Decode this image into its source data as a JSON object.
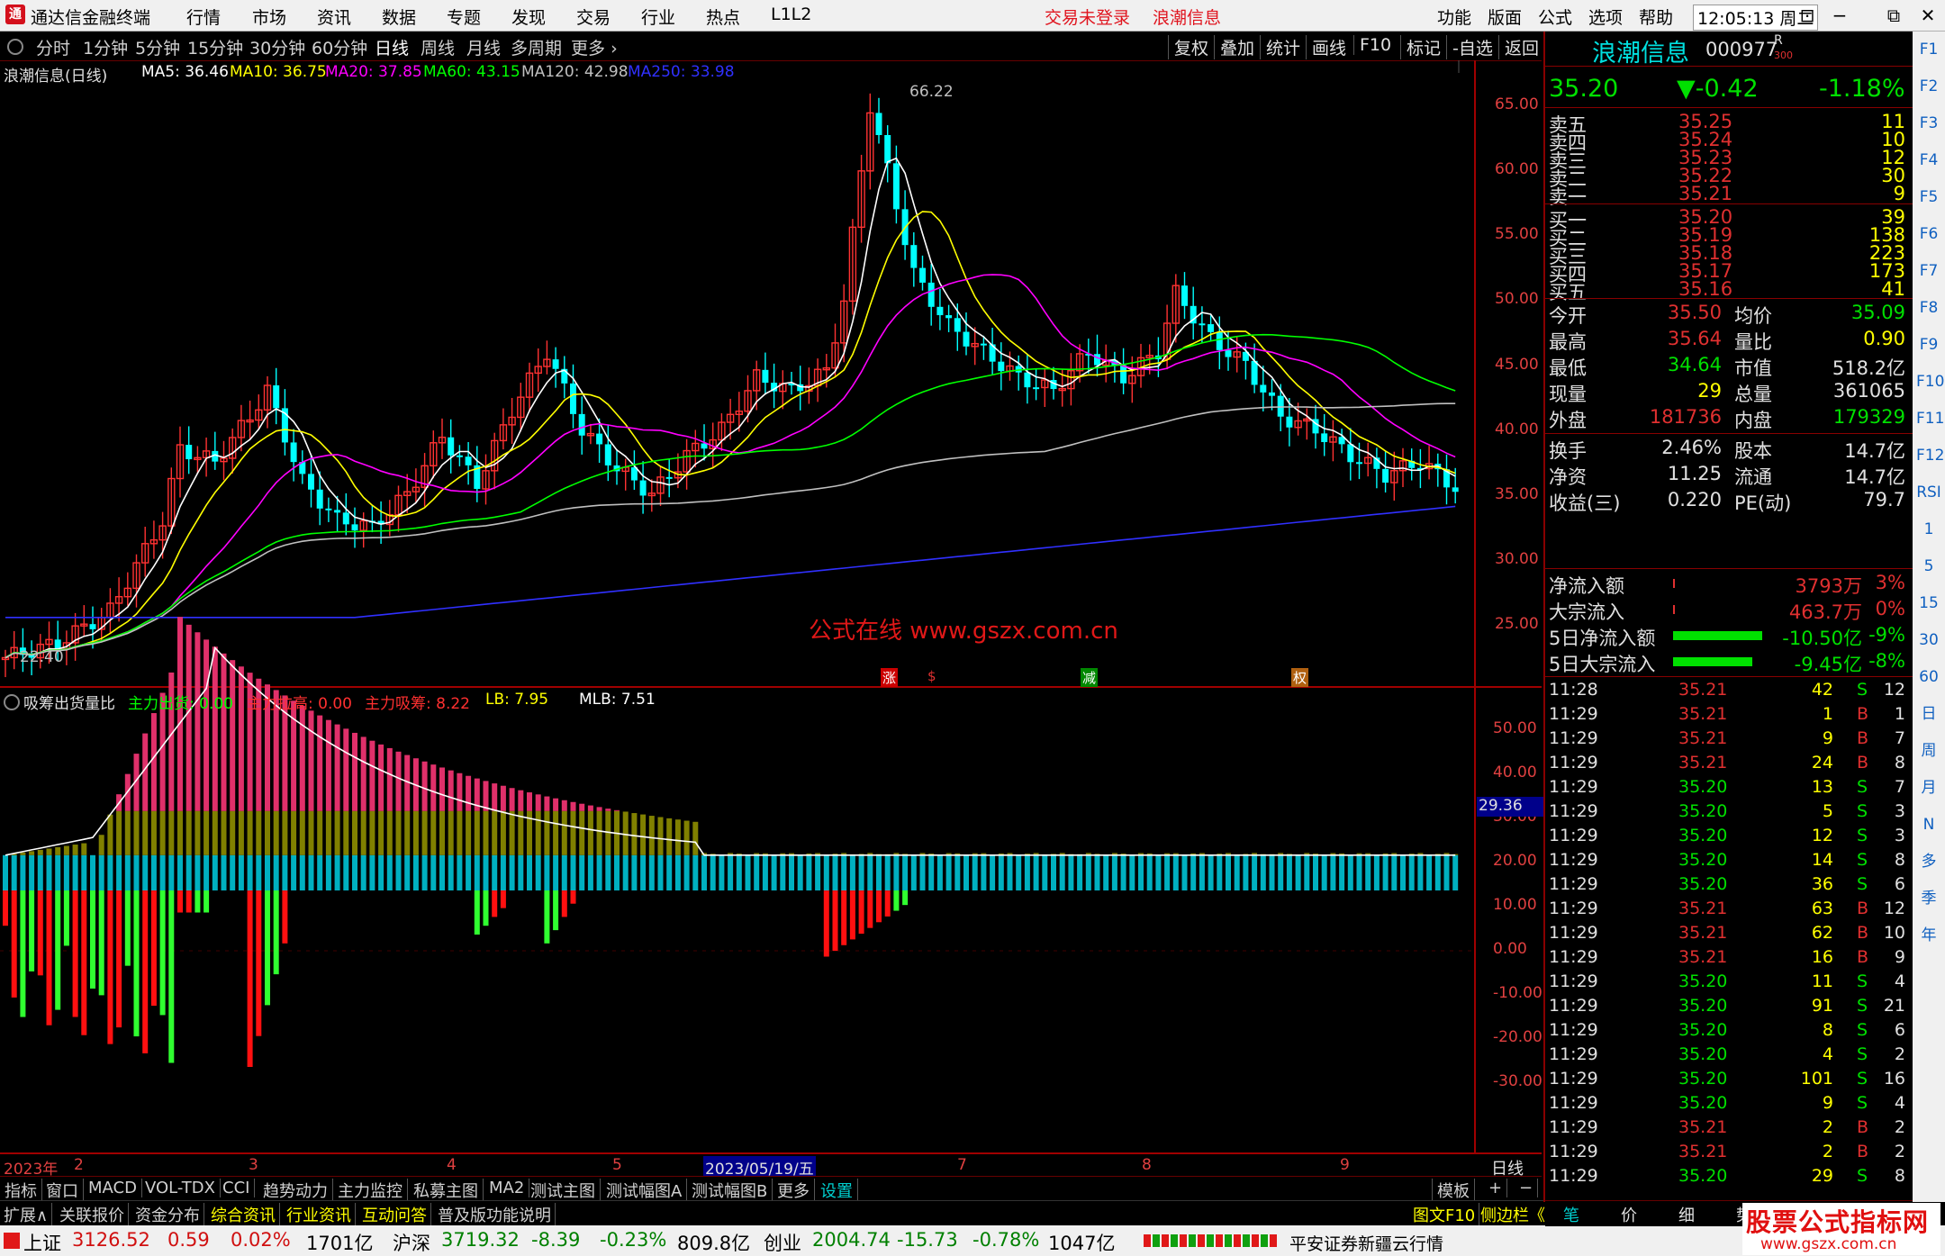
{
  "app": {
    "title": "通达信金融终端",
    "menu": [
      "行情",
      "市场",
      "资讯",
      "数据",
      "专题",
      "发现",
      "交易",
      "行业",
      "热点",
      "L1L2"
    ],
    "login_status": "交易未登录",
    "stock_tab": "浪潮信息",
    "right_menu": [
      "功能",
      "版面",
      "公式",
      "选项",
      "帮助"
    ],
    "time": "12:05:13",
    "weekday": "周二",
    "window_buttons": [
      "✕",
      "⧉",
      "−",
      "⊡"
    ]
  },
  "periods": [
    "分时",
    "1分钟",
    "5分钟",
    "15分钟",
    "30分钟",
    "60分钟",
    "日线",
    "周线",
    "月线",
    "多周期",
    "更多"
  ],
  "active_period": "日线",
  "chart_tools": [
    "复权",
    "叠加",
    "统计",
    "画线",
    "F10",
    "标记",
    "-自选",
    "返回"
  ],
  "main_chart": {
    "title": "浪潮信息(日线)",
    "ma": [
      {
        "label": "MA5: 36.46",
        "color": "#ffffff"
      },
      {
        "label": "MA10: 36.75",
        "color": "#ffff00"
      },
      {
        "label": "MA20: 37.85",
        "color": "#ff00ff"
      },
      {
        "label": "MA60: 43.15",
        "color": "#00ff00"
      },
      {
        "label": "MA120: 42.98",
        "color": "#c0c0c0"
      },
      {
        "label": "MA250: 33.98",
        "color": "#3030ff"
      }
    ],
    "high_label": "66.22",
    "low_label": "22.40",
    "yticks": [
      "65.00",
      "60.00",
      "55.00",
      "50.00",
      "45.00",
      "40.00",
      "35.00",
      "30.00",
      "25.00"
    ],
    "watermark": "公式在线  www.gszx.com.cn",
    "event_marks": [
      "涨",
      "$",
      "减",
      "权"
    ]
  },
  "indicator": {
    "title": "吸筹出货量比",
    "items": [
      {
        "label": "主力出货: 0.00",
        "color": "#00ff00"
      },
      {
        "label": "主力拉高: 0.00",
        "color": "#ff3030"
      },
      {
        "label": "主力吸筹: 8.22",
        "color": "#ff3030"
      },
      {
        "label": "LB: 7.95",
        "color": "#ffff00"
      },
      {
        "label": "MLB: 7.51",
        "color": "#ffffff"
      }
    ],
    "yticks": [
      "50.00",
      "40.00",
      "30.00",
      "20.00",
      "10.00",
      "0.00",
      "-10.00",
      "-20.00",
      "-30.00"
    ],
    "current_value": "29.36"
  },
  "dates": [
    "2023年",
    "2",
    "3",
    "4",
    "5",
    "2023/05/19/五",
    "7",
    "8",
    "9"
  ],
  "bottom_period": "日线",
  "tabs": [
    "指标",
    "窗口",
    "MACD",
    "VOL-TDX",
    "CCI",
    "趋势动力",
    "主力监控",
    "私募主图",
    "MA2",
    "测试主图",
    "测试幅图A",
    "测试幅图B",
    "更多",
    "设置"
  ],
  "tabs_right": [
    "模板",
    "+",
    "−"
  ],
  "tabs2": [
    "扩展∧",
    "关联报价",
    "资金分布",
    "综合资讯",
    "行业资讯",
    "互动问答",
    "普及版功能说明"
  ],
  "tabs2_right": [
    "图文F10",
    "侧边栏《"
  ],
  "status": {
    "sh": {
      "name": "上证",
      "value": "3126.52",
      "chg": "0.59",
      "pct": "0.02%",
      "amt": "1701亿"
    },
    "hs": {
      "name": "沪深",
      "value": "3719.32",
      "chg": "-8.39",
      "pct": "-0.23%",
      "amt": "809.8亿"
    },
    "cy": {
      "name": "创业",
      "value": "2004.74",
      "chg": "-15.73",
      "pct": "-0.78%",
      "amt": "1047亿"
    },
    "broker": "平安证券新疆云行情"
  },
  "quote": {
    "name": "浪潮信息",
    "code": "000977",
    "tag": "R",
    "tag2": "300",
    "price": "35.20",
    "change": "▼-0.42",
    "pct": "-1.18%",
    "sell": [
      {
        "label": "卖五",
        "price": "35.25",
        "vol": "11"
      },
      {
        "label": "卖四",
        "price": "35.24",
        "vol": "10"
      },
      {
        "label": "卖三",
        "price": "35.23",
        "vol": "12"
      },
      {
        "label": "卖二",
        "price": "35.22",
        "vol": "30"
      },
      {
        "label": "卖一",
        "price": "35.21",
        "vol": "9"
      }
    ],
    "buy": [
      {
        "label": "买一",
        "price": "35.20",
        "vol": "39"
      },
      {
        "label": "买二",
        "price": "35.19",
        "vol": "138"
      },
      {
        "label": "买三",
        "price": "35.18",
        "vol": "223"
      },
      {
        "label": "买四",
        "price": "35.17",
        "vol": "173"
      },
      {
        "label": "买五",
        "price": "35.16",
        "vol": "41"
      }
    ],
    "stats": [
      [
        "今开",
        "35.50",
        "均价",
        "35.09"
      ],
      [
        "最高",
        "35.64",
        "量比",
        "0.90"
      ],
      [
        "最低",
        "34.64",
        "市值",
        "518.2亿"
      ],
      [
        "现量",
        "29",
        "总量",
        "361065"
      ],
      [
        "外盘",
        "181736",
        "内盘",
        "179329"
      ]
    ],
    "stats2": [
      [
        "换手",
        "2.46%",
        "股本",
        "14.7亿"
      ],
      [
        "净资",
        "11.25",
        "流通",
        "14.7亿"
      ],
      [
        "收益(三)",
        "0.220",
        "PE(动)",
        "79.7"
      ]
    ],
    "flows": [
      {
        "label": "净流入额",
        "value": "3793万",
        "pct": "3%",
        "bar": 0.0
      },
      {
        "label": "大宗流入",
        "value": "463.7万",
        "pct": "0%",
        "bar": 0.0
      },
      {
        "label": "5日净流入额",
        "value": "-10.50亿",
        "pct": "-9%",
        "bar": 0.9
      },
      {
        "label": "5日大宗流入",
        "value": "-9.45亿",
        "pct": "-8%",
        "bar": 0.8
      }
    ],
    "ticks": [
      [
        "11:28",
        "35.21",
        "42",
        "S",
        "12"
      ],
      [
        "11:29",
        "35.21",
        "1",
        "B",
        "1"
      ],
      [
        "11:29",
        "35.21",
        "9",
        "B",
        "7"
      ],
      [
        "11:29",
        "35.21",
        "24",
        "B",
        "8"
      ],
      [
        "11:29",
        "35.20",
        "13",
        "S",
        "7"
      ],
      [
        "11:29",
        "35.20",
        "5",
        "S",
        "3"
      ],
      [
        "11:29",
        "35.20",
        "12",
        "S",
        "3"
      ],
      [
        "11:29",
        "35.20",
        "14",
        "S",
        "8"
      ],
      [
        "11:29",
        "35.20",
        "36",
        "S",
        "6"
      ],
      [
        "11:29",
        "35.21",
        "63",
        "B",
        "12"
      ],
      [
        "11:29",
        "35.21",
        "62",
        "B",
        "10"
      ],
      [
        "11:29",
        "35.21",
        "16",
        "B",
        "9"
      ],
      [
        "11:29",
        "35.20",
        "11",
        "S",
        "4"
      ],
      [
        "11:29",
        "35.20",
        "91",
        "S",
        "21"
      ],
      [
        "11:29",
        "35.20",
        "8",
        "S",
        "6"
      ],
      [
        "11:29",
        "35.20",
        "4",
        "S",
        "2"
      ],
      [
        "11:29",
        "35.20",
        "101",
        "S",
        "16"
      ],
      [
        "11:29",
        "35.20",
        "9",
        "S",
        "4"
      ],
      [
        "11:29",
        "35.21",
        "2",
        "B",
        "2"
      ],
      [
        "11:29",
        "35.21",
        "2",
        "B",
        "2"
      ],
      [
        "11:29",
        "35.20",
        "29",
        "S",
        "8"
      ]
    ],
    "bottom_tabs": [
      "笔",
      "价",
      "细",
      "势"
    ]
  },
  "side_icons": [
    "F1",
    "F2",
    "F3",
    "F4",
    "F5",
    "F6",
    "F7",
    "F8",
    "F9",
    "F10",
    "F11",
    "F12",
    "RSI",
    "1",
    "5",
    "15",
    "30",
    "60",
    "日",
    "周",
    "月",
    "N",
    "多",
    "季",
    "年"
  ],
  "logo": {
    "line1": "股票公式指标网",
    "line2": "www.gszx.com.cn"
  }
}
